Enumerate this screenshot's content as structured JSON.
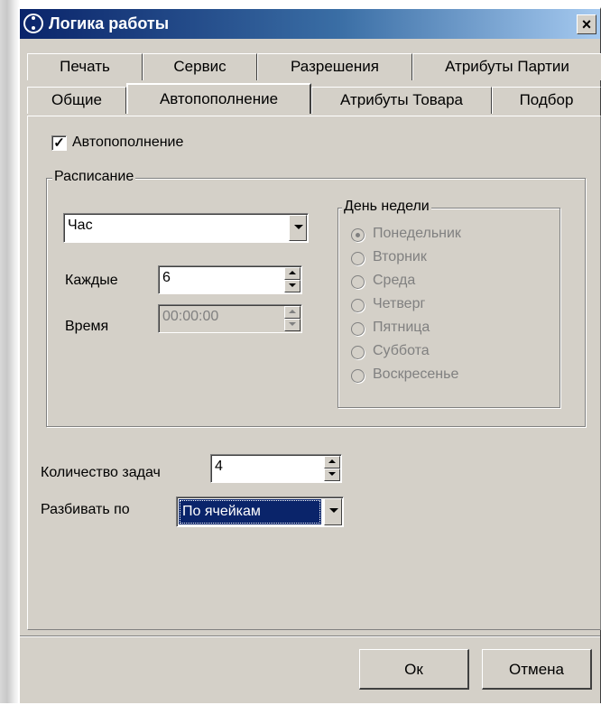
{
  "window": {
    "title": "Логика работы",
    "close_glyph": "×"
  },
  "tabs": {
    "row1": [
      "Печать",
      "Сервис",
      "Разрешения",
      "Атрибуты Партии"
    ],
    "row2": [
      "Общие",
      "Автопополнение",
      "Атрибуты Товара",
      "Подбор"
    ],
    "active": "Автопополнение"
  },
  "autorefill": {
    "checkbox_label": "Автопополнение",
    "checked": true,
    "check_glyph": "✓"
  },
  "schedule": {
    "group_title": "Расписание",
    "period_value": "Час",
    "every_label": "Каждые",
    "every_value": "6",
    "time_label": "Время",
    "time_value": "00:00:00",
    "weekday": {
      "group_title": "День недели",
      "options": [
        "Понедельник",
        "Вторник",
        "Среда",
        "Четверг",
        "Пятница",
        "Суббота",
        "Воскресенье"
      ],
      "selected": "Понедельник"
    }
  },
  "tasks": {
    "label": "Количество задач",
    "value": "4"
  },
  "split": {
    "label": "Разбивать по",
    "value": "По ячейкам"
  },
  "buttons": {
    "ok": "Ок",
    "cancel": "Отмена"
  },
  "colors": {
    "title_gradient_start": "#0a246a",
    "title_gradient_end": "#a6caf0",
    "face": "#d4d0c8",
    "selection": "#0a246a"
  }
}
